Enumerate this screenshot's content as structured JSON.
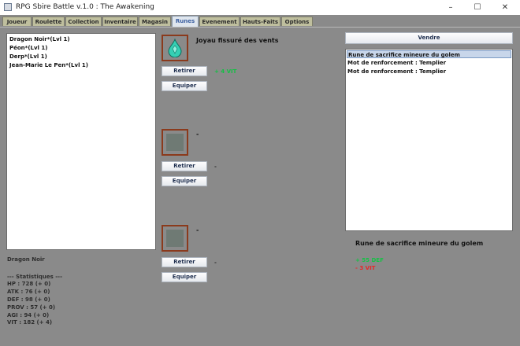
{
  "window": {
    "title": "RPG Sbire Battle v.1.0 : The Awakening",
    "minimize": "–",
    "maximize": "☐",
    "close": "✕"
  },
  "tabs": [
    "Joueur",
    "Roulette",
    "Collection",
    "Inventaire",
    "Magasin",
    "Runes",
    "Evenement",
    "Hauts-Faits",
    "Options"
  ],
  "active_tab": "Runes",
  "characters": [
    "Dragon Noir*(Lvl 1)",
    "Péon*(Lvl 1)",
    "Derp*(Lvl 1)",
    "Jean-Marie Le Pen*(Lvl 1)"
  ],
  "selected_character": {
    "name": "Dragon Noir",
    "stats_header": "--- Statistiques ---",
    "stats": [
      "HP : 728 (+ 0)",
      "ATK : 76 (+ 0)",
      "DEF : 98 (+ 0)",
      "PROV : 57 (+ 0)",
      "AGI : 94 (+ 0)",
      "VIT : 182 (+ 4)"
    ]
  },
  "slots": [
    {
      "name": "Joyau fissuré des vents",
      "bonus": "+ 4 VIT",
      "bonus_color": "#15c045",
      "remove_label": "Retirer",
      "equip_label": "Equiper",
      "icon": "teal-drop-gem-icon"
    },
    {
      "name": "-",
      "bonus": "-",
      "remove_label": "Retirer",
      "equip_label": "Equiper"
    },
    {
      "name": "-",
      "bonus": "-",
      "remove_label": "Retirer",
      "equip_label": "Equiper"
    }
  ],
  "sell_label": "Vendre",
  "runes": [
    "Rune de sacrifice mineure du golem",
    "Mot de renforcement : Templier",
    "Mot de renforcement : Templier"
  ],
  "selected_rune_index": 0,
  "rune_detail": {
    "name": "Rune de sacrifice mineure du golem",
    "bonuses": [
      {
        "text": "+ 55 DEF",
        "color": "#15c045"
      },
      {
        "text": "- 3 VIT",
        "color": "#e8262a"
      }
    ]
  },
  "colors": {
    "background": "#8a8a8a",
    "slot_border": "#8b3a1c",
    "tab": "#bfbf9e",
    "active_tab_text": "#3b5fa0"
  }
}
